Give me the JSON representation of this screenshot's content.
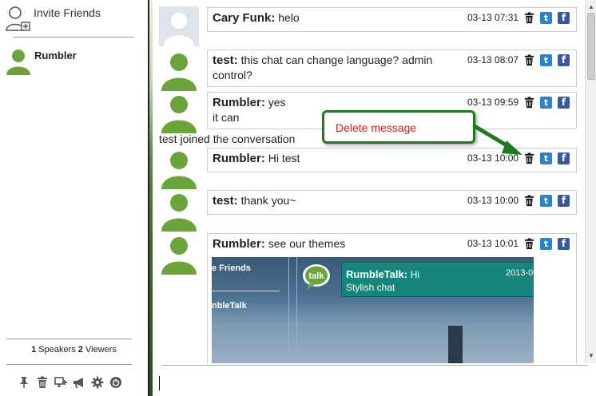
{
  "sidebar": {
    "invite_label": "Invite Friends",
    "users": [
      {
        "name": "Rumbler"
      }
    ],
    "counts": {
      "speakers_num": "1",
      "speakers_label": "Speakers",
      "viewers_num": "2",
      "viewers_label": "Viewers"
    },
    "toolbar": [
      "pin-icon",
      "trash-icon",
      "add-screen-icon",
      "megaphone-icon",
      "gear-icon",
      "power-icon"
    ]
  },
  "messages": [
    {
      "user": "Cary Funk:",
      "text": "helo",
      "time": "03-13 07:31",
      "avatar": "gray"
    },
    {
      "user": "test:",
      "text": "this chat can change language? admin control?",
      "time": "03-13 08:07",
      "avatar": "green"
    },
    {
      "user": "Rumbler:",
      "text": "yes",
      "text2": "it can",
      "time": "03-13 09:59",
      "avatar": "green"
    },
    {
      "user": "Rumbler:",
      "text": "Hi test",
      "time": "03-13 10:00",
      "avatar": "green"
    },
    {
      "user": "test:",
      "text": "thank you~",
      "time": "03-13 10:00",
      "avatar": "green"
    },
    {
      "user": "Rumbler:",
      "text": "see our themes",
      "time": "03-13 10:01",
      "avatar": "green"
    }
  ],
  "system_message": "test joined the conversation",
  "theme_preview": {
    "invite_fragment": "e Friends",
    "brand_fragment": "nbleTalk",
    "bubble_logo": "talk",
    "panel_user": "RumbleTalk:",
    "panel_text": "Hi",
    "panel_sub": "Stylish chat",
    "panel_date": "2013-0"
  },
  "tooltip": {
    "text": "Delete message"
  },
  "input": {
    "value": ""
  },
  "colors": {
    "accent_green": "#6aa43a",
    "tooltip_border": "#1f7a1f",
    "tooltip_text": "#d21b1b",
    "twitter": "#2d82c8",
    "facebook": "#3b5998"
  }
}
